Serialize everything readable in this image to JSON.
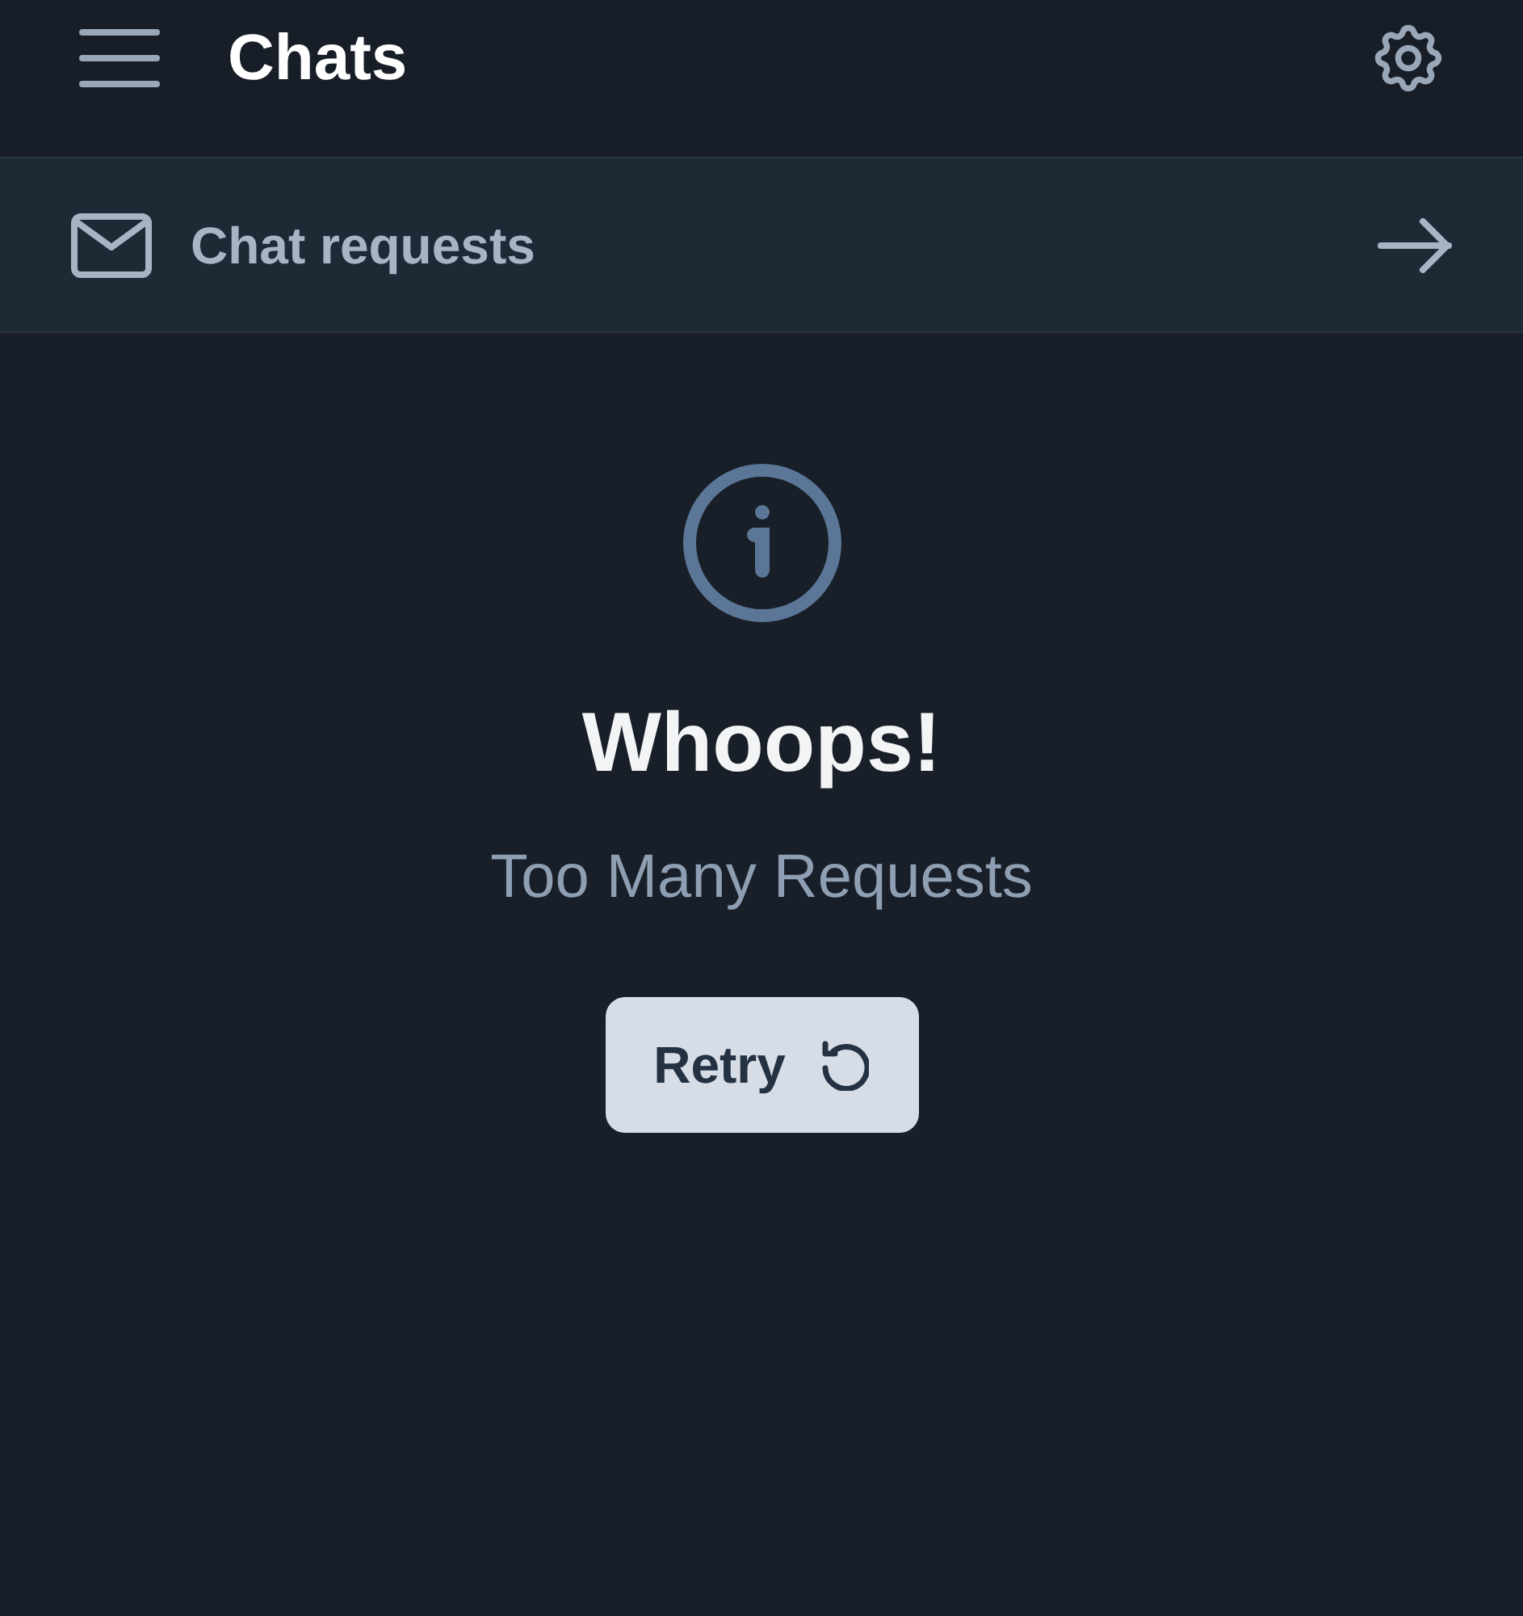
{
  "header": {
    "title": "Chats"
  },
  "chat_requests": {
    "label": "Chat requests"
  },
  "error": {
    "title": "Whoops!",
    "message": "Too Many Requests",
    "button": "Retry"
  }
}
